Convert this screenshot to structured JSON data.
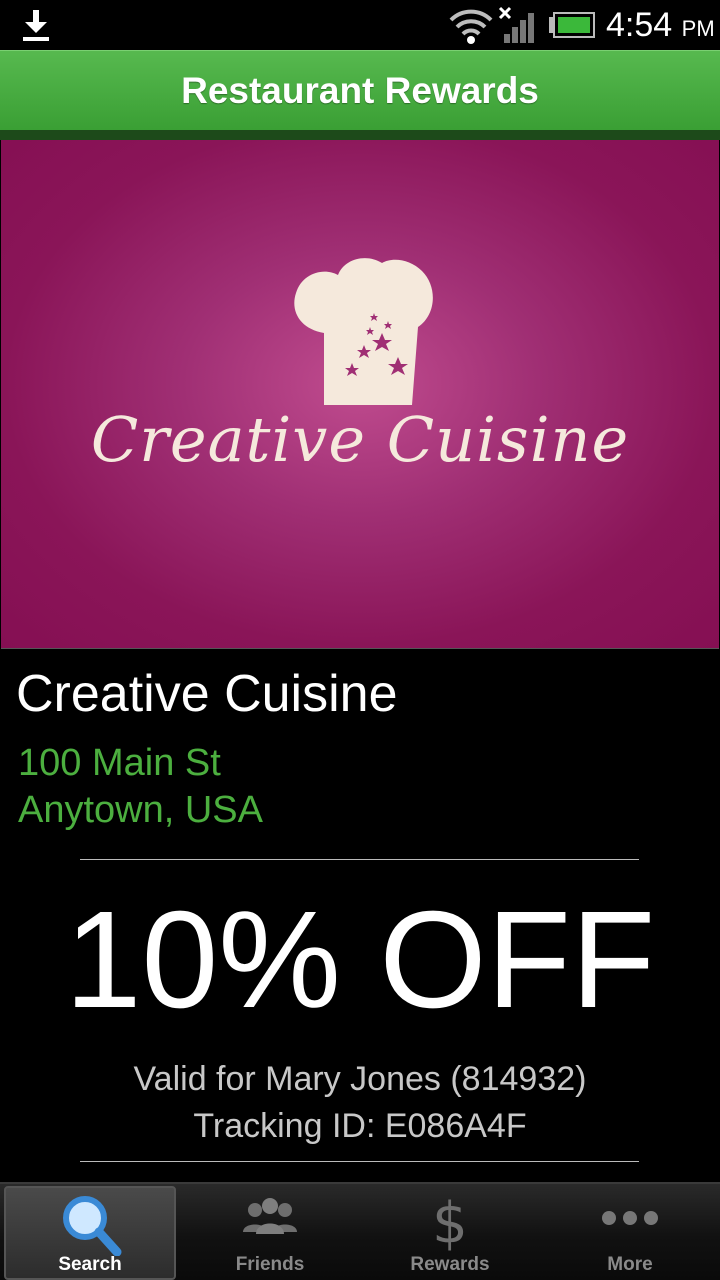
{
  "status_bar": {
    "time": "4:54",
    "ampm": "PM",
    "icons": [
      "download-icon",
      "wifi-icon",
      "signal-icon",
      "battery-icon"
    ]
  },
  "app": {
    "title": "Restaurant Rewards",
    "accent_color": "#4caf3f"
  },
  "hero": {
    "logo_text": "Creative Cuisine",
    "background_color": "#8a1558",
    "logo_color": "#f5e9dc",
    "icon": "chef-hat-icon"
  },
  "restaurant": {
    "name": "Creative Cuisine",
    "address_line1": "100 Main St",
    "address_line2": "Anytown, USA"
  },
  "offer": {
    "discount": "10% OFF",
    "valid_for": "Valid for Mary Jones (814932)",
    "tracking": "Tracking ID: E086A4F"
  },
  "tabs": [
    {
      "label": "Search",
      "icon": "search-icon",
      "selected": true
    },
    {
      "label": "Friends",
      "icon": "friends-icon",
      "selected": false
    },
    {
      "label": "Rewards",
      "icon": "dollar-icon",
      "selected": false
    },
    {
      "label": "More",
      "icon": "more-icon",
      "selected": false
    }
  ]
}
